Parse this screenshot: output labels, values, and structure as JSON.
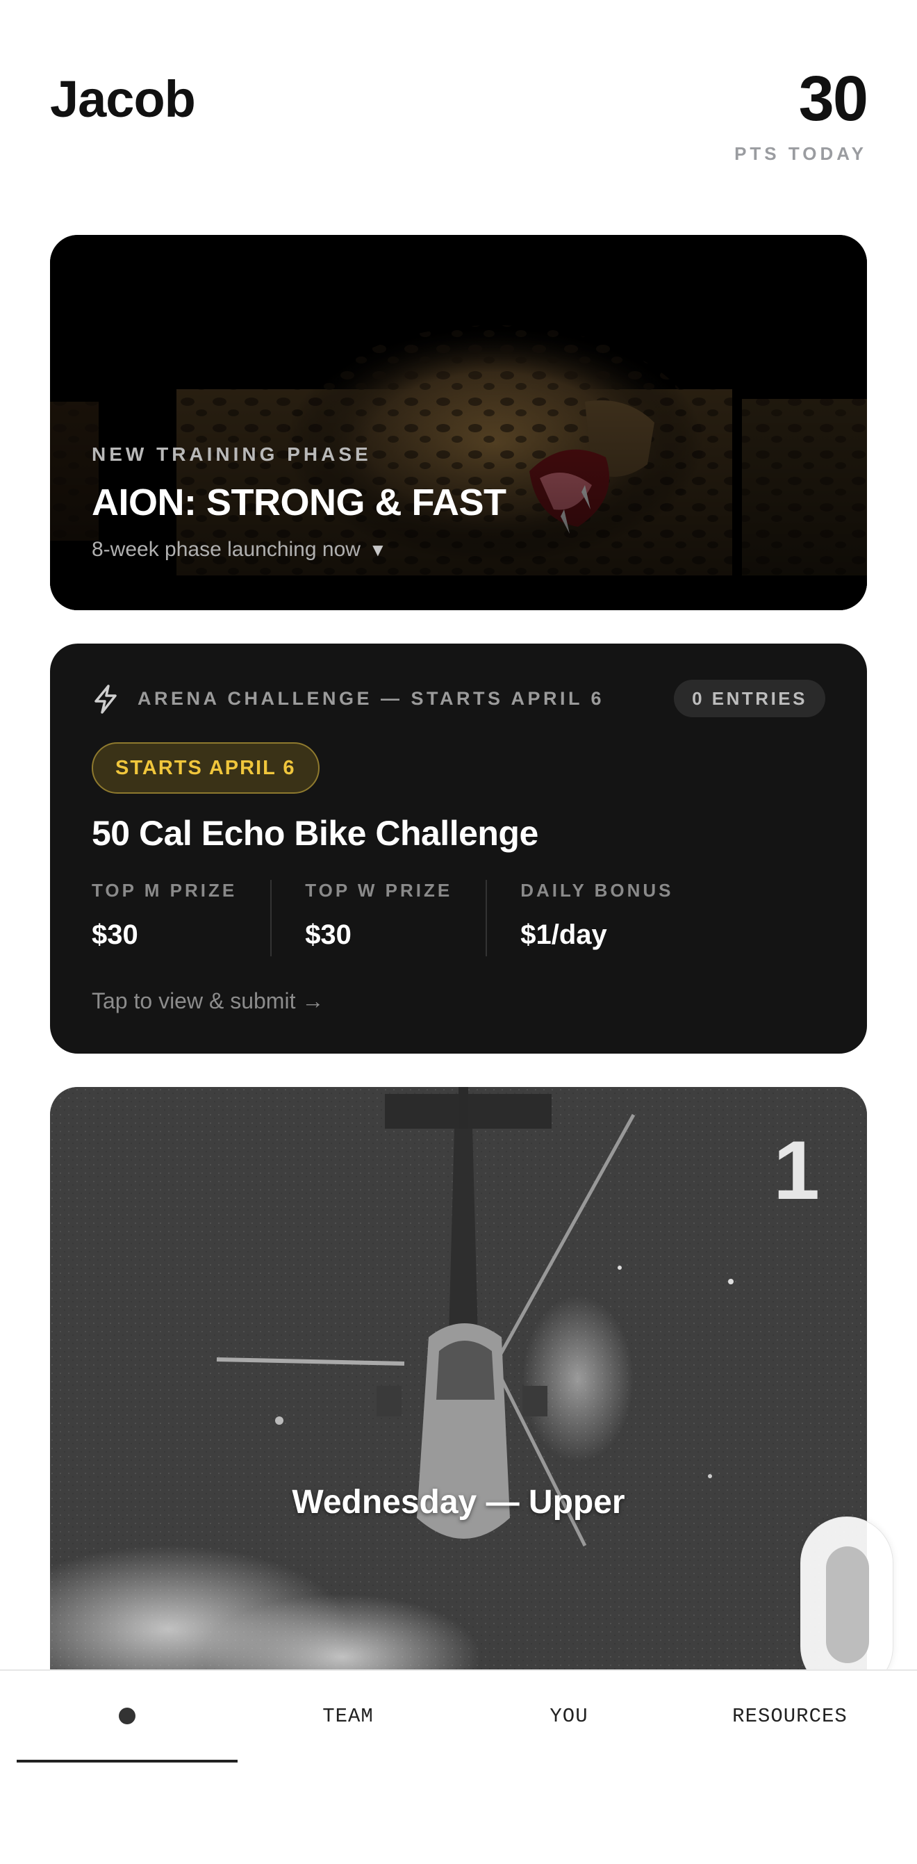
{
  "header": {
    "user_name": "Jacob",
    "points": "30",
    "points_label": "PTS TODAY"
  },
  "phase_card": {
    "eyebrow": "NEW TRAINING PHASE",
    "title": "AION: STRONG & FAST",
    "subtitle": "8-week phase launching now",
    "caret": "▼"
  },
  "challenge_card": {
    "label": "ARENA CHALLENGE — STARTS APRIL 6",
    "entries": "0 ENTRIES",
    "status_pill": "STARTS APRIL 6",
    "title": "50 Cal Echo Bike Challenge",
    "prizes": [
      {
        "label": "TOP M PRIZE",
        "value": "$30"
      },
      {
        "label": "TOP W PRIZE",
        "value": "$30"
      },
      {
        "label": "DAILY BONUS",
        "value": "$1/day"
      }
    ],
    "cta": "Tap to view & submit →",
    "accent_color": "#f0c63c"
  },
  "workout_card": {
    "number": "1",
    "title": "Wednesday — Upper"
  },
  "bottom_nav": {
    "items": [
      {
        "label": "",
        "icon": "home-dot-icon",
        "active": true
      },
      {
        "label": "TEAM",
        "active": false
      },
      {
        "label": "YOU",
        "active": false
      },
      {
        "label": "RESOURCES",
        "active": false
      }
    ]
  }
}
